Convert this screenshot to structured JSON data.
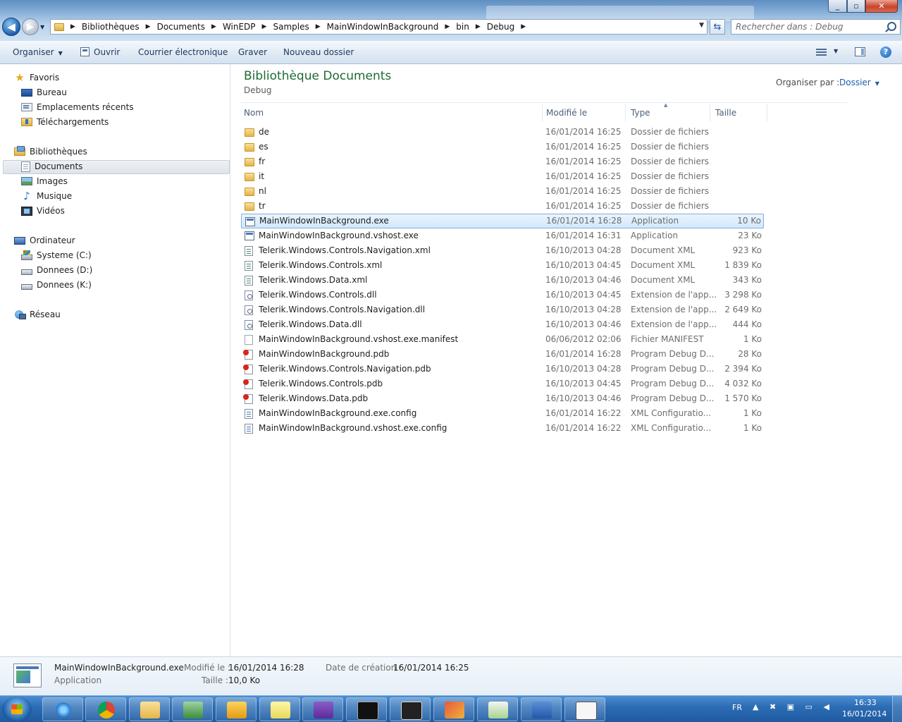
{
  "address": {
    "crumbs": [
      "Bibliothèques",
      "Documents",
      "WinEDP",
      "Samples",
      "MainWindowInBackground",
      "bin",
      "Debug"
    ]
  },
  "search": {
    "placeholder": "Rechercher dans : Debug"
  },
  "toolbar": {
    "organize": "Organiser",
    "open": "Ouvrir",
    "email": "Courrier électronique",
    "burn": "Graver",
    "new_folder": "Nouveau dossier"
  },
  "nav": {
    "favorites": "Favoris",
    "desktop": "Bureau",
    "recent": "Emplacements récents",
    "downloads": "Téléchargements",
    "libraries": "Bibliothèques",
    "documents": "Documents",
    "images": "Images",
    "music": "Musique",
    "videos": "Vidéos",
    "computer": "Ordinateur",
    "drive_c": "Systeme (C:)",
    "drive_d": "Donnees (D:)",
    "drive_k": "Donnees (K:)",
    "network": "Réseau"
  },
  "content": {
    "title": "Bibliothèque Documents",
    "subtitle": "Debug",
    "arrange_label": "Organiser par :",
    "arrange_value": "Dossier",
    "columns": {
      "name": "Nom",
      "modified": "Modifié le",
      "type": "Type",
      "size": "Taille"
    },
    "files": [
      {
        "name": "de",
        "date": "16/01/2014 16:25",
        "type": "Dossier de fichiers",
        "size": "",
        "icon": "folder"
      },
      {
        "name": "es",
        "date": "16/01/2014 16:25",
        "type": "Dossier de fichiers",
        "size": "",
        "icon": "folder"
      },
      {
        "name": "fr",
        "date": "16/01/2014 16:25",
        "type": "Dossier de fichiers",
        "size": "",
        "icon": "folder"
      },
      {
        "name": "it",
        "date": "16/01/2014 16:25",
        "type": "Dossier de fichiers",
        "size": "",
        "icon": "folder"
      },
      {
        "name": "nl",
        "date": "16/01/2014 16:25",
        "type": "Dossier de fichiers",
        "size": "",
        "icon": "folder"
      },
      {
        "name": "tr",
        "date": "16/01/2014 16:25",
        "type": "Dossier de fichiers",
        "size": "",
        "icon": "folder"
      },
      {
        "name": "MainWindowInBackground.exe",
        "date": "16/01/2014 16:28",
        "type": "Application",
        "size": "10 Ko",
        "icon": "app"
      },
      {
        "name": "MainWindowInBackground.vshost.exe",
        "date": "16/01/2014 16:31",
        "type": "Application",
        "size": "23 Ko",
        "icon": "app"
      },
      {
        "name": "Telerik.Windows.Controls.Navigation.xml",
        "date": "16/10/2013 04:28",
        "type": "Document XML",
        "size": "923 Ko",
        "icon": "xml"
      },
      {
        "name": "Telerik.Windows.Controls.xml",
        "date": "16/10/2013 04:45",
        "type": "Document XML",
        "size": "1 839 Ko",
        "icon": "xml"
      },
      {
        "name": "Telerik.Windows.Data.xml",
        "date": "16/10/2013 04:46",
        "type": "Document XML",
        "size": "343 Ko",
        "icon": "xml"
      },
      {
        "name": "Telerik.Windows.Controls.dll",
        "date": "16/10/2013 04:45",
        "type": "Extension de l'app...",
        "size": "3 298 Ko",
        "icon": "dll"
      },
      {
        "name": "Telerik.Windows.Controls.Navigation.dll",
        "date": "16/10/2013 04:28",
        "type": "Extension de l'app...",
        "size": "2 649 Ko",
        "icon": "dll"
      },
      {
        "name": "Telerik.Windows.Data.dll",
        "date": "16/10/2013 04:46",
        "type": "Extension de l'app...",
        "size": "444 Ko",
        "icon": "dll"
      },
      {
        "name": "MainWindowInBackground.vshost.exe.manifest",
        "date": "06/06/2012 02:06",
        "type": "Fichier MANIFEST",
        "size": "1 Ko",
        "icon": "manifest"
      },
      {
        "name": "MainWindowInBackground.pdb",
        "date": "16/01/2014 16:28",
        "type": "Program Debug D...",
        "size": "28 Ko",
        "icon": "pdb"
      },
      {
        "name": "Telerik.Windows.Controls.Navigation.pdb",
        "date": "16/10/2013 04:28",
        "type": "Program Debug D...",
        "size": "2 394 Ko",
        "icon": "pdb"
      },
      {
        "name": "Telerik.Windows.Controls.pdb",
        "date": "16/10/2013 04:45",
        "type": "Program Debug D...",
        "size": "4 032 Ko",
        "icon": "pdb"
      },
      {
        "name": "Telerik.Windows.Data.pdb",
        "date": "16/10/2013 04:46",
        "type": "Program Debug D...",
        "size": "1 570 Ko",
        "icon": "pdb"
      },
      {
        "name": "MainWindowInBackground.exe.config",
        "date": "16/01/2014 16:22",
        "type": "XML Configuratio...",
        "size": "1 Ko",
        "icon": "config"
      },
      {
        "name": "MainWindowInBackground.vshost.exe.config",
        "date": "16/01/2014 16:22",
        "type": "XML Configuratio...",
        "size": "1 Ko",
        "icon": "config"
      }
    ],
    "selected_index": 6
  },
  "details": {
    "filename": "MainWindowInBackground.exe",
    "filetype": "Application",
    "modified_label": "Modifié le :",
    "modified_value": "16/01/2014 16:28",
    "size_label": "Taille :",
    "size_value": "10,0 Ko",
    "created_label": "Date de création :",
    "created_value": "16/01/2014 16:25"
  },
  "taskbar": {
    "language": "FR",
    "time": "16:33",
    "date": "16/01/2014"
  },
  "colors": {
    "library_title": "#1e6b34",
    "taskbar": "#2c6db5",
    "selection": "#d3e8fb"
  }
}
